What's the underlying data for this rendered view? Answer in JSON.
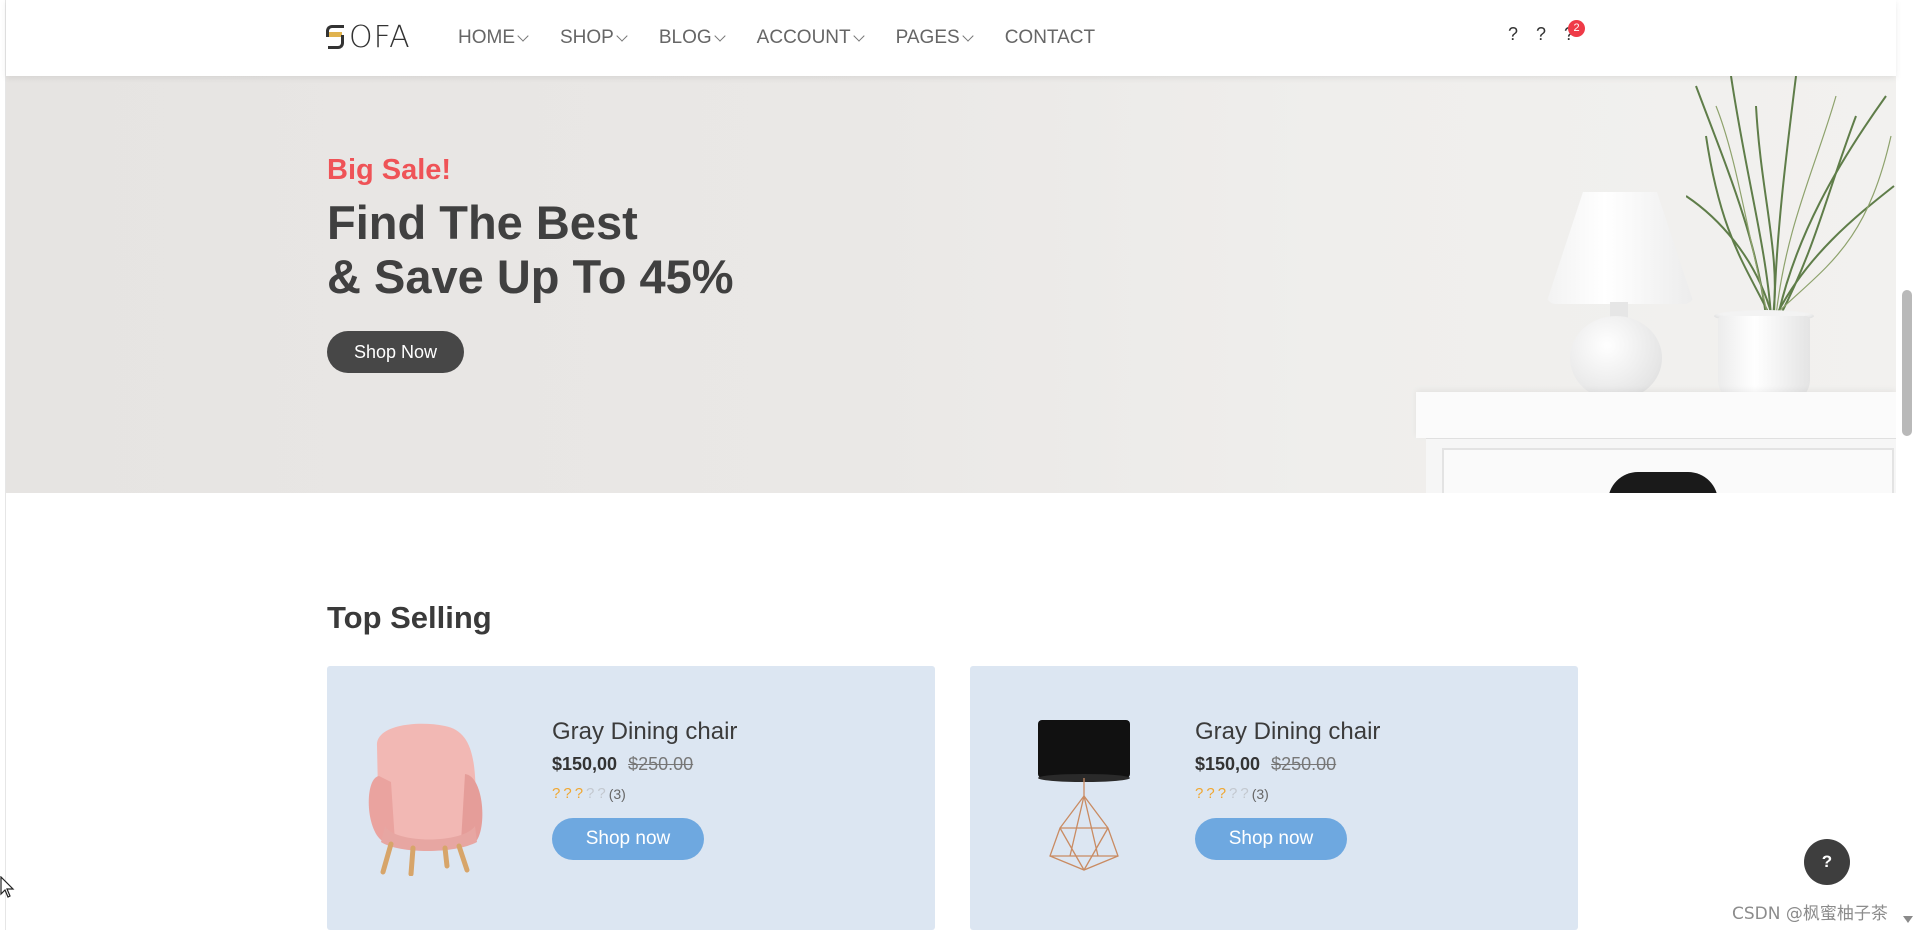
{
  "header": {
    "logo_text": "OFA",
    "nav": [
      {
        "label": "HOME",
        "has_dropdown": true
      },
      {
        "label": "SHOP",
        "has_dropdown": true
      },
      {
        "label": "BLOG",
        "has_dropdown": true
      },
      {
        "label": "ACCOUNT",
        "has_dropdown": true
      },
      {
        "label": "PAGES",
        "has_dropdown": true
      },
      {
        "label": "CONTACT",
        "has_dropdown": false
      }
    ],
    "icons": {
      "search": "?",
      "wishlist": "?",
      "cart": "?",
      "cart_count": "2"
    }
  },
  "hero": {
    "kicker": "Big Sale!",
    "title_line1": "Find The Best",
    "title_line2": "& Save Up To 45%",
    "button_label": "Shop Now"
  },
  "top_selling": {
    "title": "Top Selling",
    "products": [
      {
        "name": "Gray Dining chair",
        "price": "$150,00",
        "old_price": "$250.00",
        "rating": 3,
        "max_rating": 5,
        "rating_count": "(3)",
        "star_glyph": "?",
        "button_label": "Shop now",
        "image": "pink-armchair"
      },
      {
        "name": "Gray Dining chair",
        "price": "$150,00",
        "old_price": "$250.00",
        "rating": 3,
        "max_rating": 5,
        "rating_count": "(3)",
        "star_glyph": "?",
        "button_label": "Shop now",
        "image": "black-table-lamp"
      }
    ]
  },
  "help_button": "?",
  "watermark": "CSDN @枫蜜柚子茶",
  "colors": {
    "accent_red": "#ef5357",
    "button_dark": "#474747",
    "card_bg": "#dce6f2",
    "card_button": "#6ea8e0",
    "star": "#f0a732",
    "badge": "#ef3a47"
  }
}
